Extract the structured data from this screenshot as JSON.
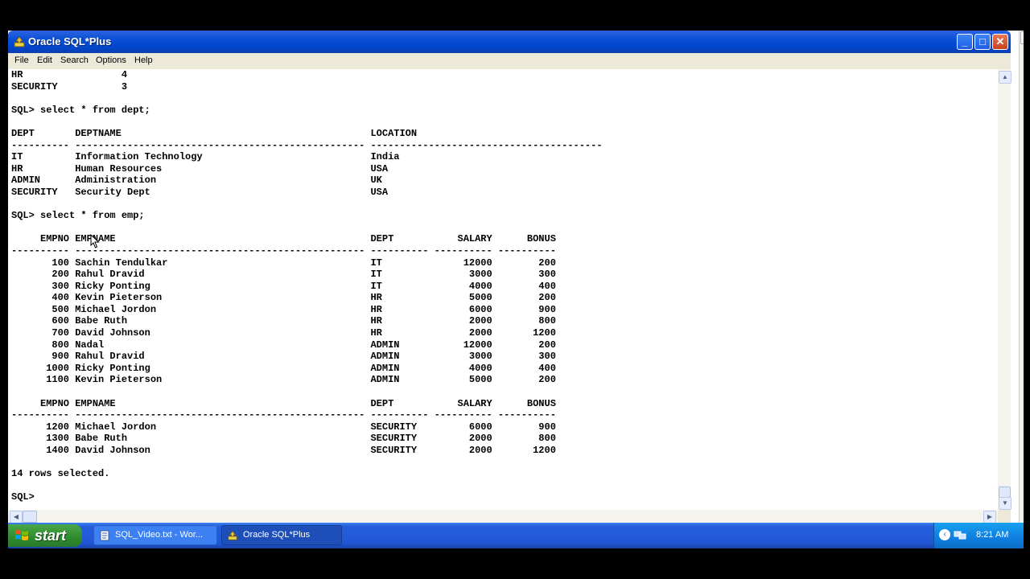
{
  "window": {
    "title": "Oracle SQL*Plus",
    "controls": {
      "minimize": "_",
      "maximize": "□",
      "close": "✕"
    }
  },
  "menu": [
    "File",
    "Edit",
    "Search",
    "Options",
    "Help"
  ],
  "console": {
    "lines": [
      "HR                 4",
      "SECURITY           3",
      "",
      "SQL> select * from dept;",
      "",
      "DEPT       DEPTNAME                                           LOCATION",
      "---------- -------------------------------------------------- ----------------------------------------",
      "IT         Information Technology                             India",
      "HR         Human Resources                                    USA",
      "ADMIN      Administration                                     UK",
      "SECURITY   Security Dept                                      USA",
      "",
      "SQL> select * from emp;",
      "",
      "     EMPNO EMPNAME                                            DEPT           SALARY      BONUS",
      "---------- -------------------------------------------------- ---------- ---------- ----------",
      "       100 Sachin Tendulkar                                   IT              12000        200",
      "       200 Rahul Dravid                                       IT               3000        300",
      "       300 Ricky Ponting                                      IT               4000        400",
      "       400 Kevin Pieterson                                    HR               5000        200",
      "       500 Michael Jordon                                     HR               6000        900",
      "       600 Babe Ruth                                          HR               2000        800",
      "       700 David Johnson                                      HR               2000       1200",
      "       800 Nadal                                              ADMIN           12000        200",
      "       900 Rahul Dravid                                       ADMIN            3000        300",
      "      1000 Ricky Ponting                                      ADMIN            4000        400",
      "      1100 Kevin Pieterson                                    ADMIN            5000        200",
      "",
      "     EMPNO EMPNAME                                            DEPT           SALARY      BONUS",
      "---------- -------------------------------------------------- ---------- ---------- ----------",
      "      1200 Michael Jordon                                     SECURITY         6000        900",
      "      1300 Babe Ruth                                          SECURITY         2000        800",
      "      1400 David Johnson                                      SECURITY         2000       1200",
      "",
      "14 rows selected.",
      "",
      "SQL>"
    ]
  },
  "taskbar": {
    "start_label": "start",
    "tasks": [
      {
        "label": "SQL_Video.txt - Wor...",
        "icon": "notepad-icon"
      },
      {
        "label": "Oracle SQL*Plus",
        "icon": "sqlplus-icon"
      }
    ],
    "clock": "8:21 AM",
    "tray_chevron": "‹"
  },
  "scroll": {
    "up": "▲",
    "down": "▼",
    "left": "◀",
    "right": "▶"
  },
  "colors": {
    "title_bar": "#0a4fd6",
    "menu_bar": "#ece9d8",
    "taskbar": "#245edb",
    "start_button": "#2e8b2e",
    "tray": "#0f7ee0"
  }
}
